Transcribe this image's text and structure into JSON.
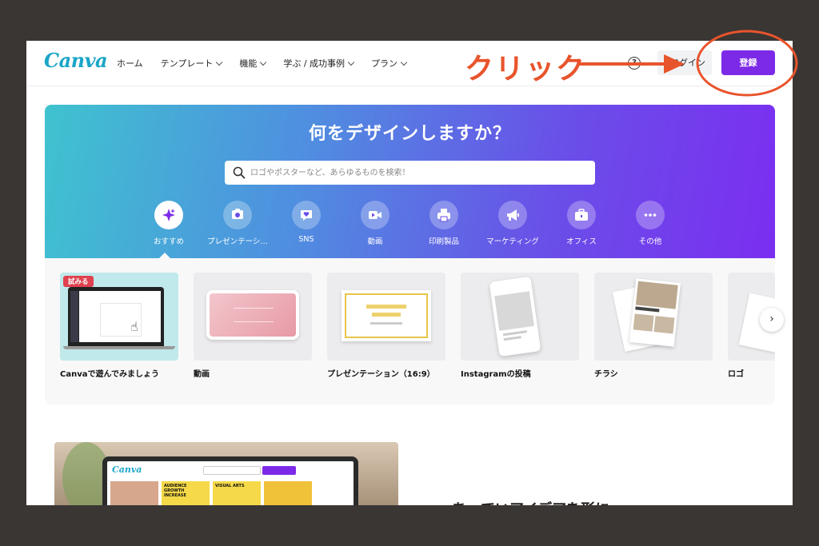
{
  "header": {
    "logo": "Canva",
    "nav": [
      {
        "label": "ホーム",
        "chevron": false
      },
      {
        "label": "テンプレート",
        "chevron": true
      },
      {
        "label": "機能",
        "chevron": true
      },
      {
        "label": "学ぶ / 成功事例",
        "chevron": true
      },
      {
        "label": "プラン",
        "chevron": true
      }
    ],
    "help": "?",
    "login_label": "ログイン",
    "signup_label": "登録"
  },
  "hero": {
    "title": "何をデザインしますか？",
    "search_placeholder": "ロゴやポスターなど、あらゆるものを検索！",
    "categories": [
      {
        "label": "おすすめ",
        "icon": "sparkle-icon",
        "active": true
      },
      {
        "label": "プレゼンテーシ…",
        "icon": "presentation-icon",
        "active": false
      },
      {
        "label": "SNS",
        "icon": "heart-chat-icon",
        "active": false
      },
      {
        "label": "動画",
        "icon": "video-icon",
        "active": false
      },
      {
        "label": "印刷製品",
        "icon": "printer-icon",
        "active": false
      },
      {
        "label": "マーケティング",
        "icon": "megaphone-icon",
        "active": false
      },
      {
        "label": "オフィス",
        "icon": "briefcase-icon",
        "active": false
      },
      {
        "label": "その他",
        "icon": "more-icon",
        "active": false
      }
    ]
  },
  "cards": [
    {
      "label": "Canvaで遊んでみましょう",
      "badge": "試みる"
    },
    {
      "label": "動画"
    },
    {
      "label": "プレゼンテーション（16:9）"
    },
    {
      "label": "Instagramの投稿"
    },
    {
      "label": "チラシ"
    },
    {
      "label": "ロゴ"
    }
  ],
  "promo": {
    "mini_logo": "Canva",
    "tile1": "AUDIENCE GROWTH INCREASE",
    "tile2": "VISUAL ARTS",
    "heading_partial": "あ　ていアイデアを形に"
  },
  "annotation": {
    "text": "クリック",
    "color": "#e8542c"
  },
  "colors": {
    "brand_purple": "#7d2ae8",
    "brand_teal": "#1aa5c7"
  }
}
